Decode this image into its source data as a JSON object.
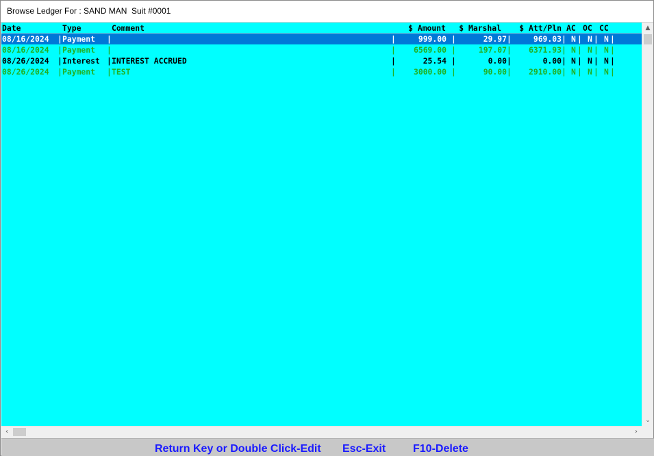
{
  "window": {
    "title": "Browse Ledger For : SAND MAN  Suit #0001"
  },
  "ledger": {
    "columns": {
      "date": "Date",
      "type": "Type",
      "comment": "Comment",
      "amount": "$ Amount",
      "marshal": "$ Marshal",
      "att_pln": "$ Att/Pln",
      "ac": "AC",
      "oc": "OC",
      "cc": "CC"
    },
    "rows": [
      {
        "date": "08/16/2024",
        "type": "Payment",
        "comment": "",
        "amount": "999.00",
        "marshal": "29.97",
        "att_pln": "969.03",
        "ac": "N",
        "oc": "N",
        "cc": "N",
        "state": "selected"
      },
      {
        "date": "08/16/2024",
        "type": "Payment",
        "comment": "",
        "amount": "6569.00",
        "marshal": "197.07",
        "att_pln": "6371.93",
        "ac": "N",
        "oc": "N",
        "cc": "N",
        "state": "green"
      },
      {
        "date": "08/26/2024",
        "type": "Interest",
        "comment": "INTEREST ACCRUED",
        "amount": "25.54",
        "marshal": "0.00",
        "att_pln": "0.00",
        "ac": "N",
        "oc": "N",
        "cc": "N",
        "state": "dark"
      },
      {
        "date": "08/26/2024",
        "type": "Payment",
        "comment": "TEST",
        "amount": "3000.00",
        "marshal": "90.00",
        "att_pln": "2910.00",
        "ac": "N",
        "oc": "N",
        "cc": "N",
        "state": "green"
      }
    ],
    "separator": "|"
  },
  "scrollbars": {
    "up_icon": "▲",
    "down_icon": "⌄",
    "left_icon": "‹",
    "right_icon": "›"
  },
  "footer": {
    "edit_hint": "Return Key or Double Click-Edit",
    "exit_hint": "Esc-Exit",
    "delete_hint": "F10-Delete"
  },
  "colors": {
    "list_background": "#00ffff",
    "selected_row": "#0078d7",
    "green_text": "#22b022",
    "footer_text": "#1a1aff"
  }
}
